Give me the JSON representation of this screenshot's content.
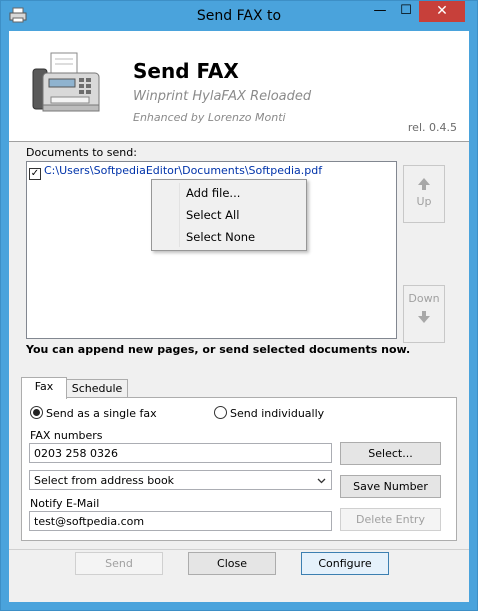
{
  "window": {
    "title": "Send FAX to",
    "controls": {
      "minimize": "—",
      "maximize": "☐",
      "close": "✕"
    }
  },
  "header": {
    "title": "Send FAX",
    "subtitle": "Winprint HylaFAX Reloaded",
    "author": "Enhanced by Lorenzo Monti",
    "version": "rel. 0.4.5",
    "icon": "fax-machine-icon"
  },
  "documents": {
    "label": "Documents to send:",
    "items": [
      {
        "checked": true,
        "path": "C:\\Users\\SoftpediaEditor\\Documents\\Softpedia.pdf"
      }
    ]
  },
  "context_menu": {
    "items": [
      "Add file...",
      "Select All",
      "Select None"
    ]
  },
  "side_buttons": {
    "up": "Up",
    "down": "Down"
  },
  "note": "You can append new pages, or send selected documents now.",
  "tabs": [
    "Fax",
    "Schedule"
  ],
  "fax_tab": {
    "radio_single": "Send as a single fax",
    "radio_individual": "Send individually",
    "selected_radio": "single",
    "fax_numbers_label": "FAX numbers",
    "fax_numbers_value": "0203 258 0326",
    "select_button": "Select...",
    "address_book_value": "Select from address book",
    "save_number_button": "Save Number",
    "notify_label": "Notify E-Mail",
    "notify_value": "test@softpedia.com",
    "delete_entry_button": "Delete Entry"
  },
  "footer": {
    "send": "Send",
    "close": "Close",
    "configure": "Configure"
  },
  "colors": {
    "frame": "#4aa3dc",
    "close_button": "#c7403a",
    "path_text": "#0033aa"
  }
}
